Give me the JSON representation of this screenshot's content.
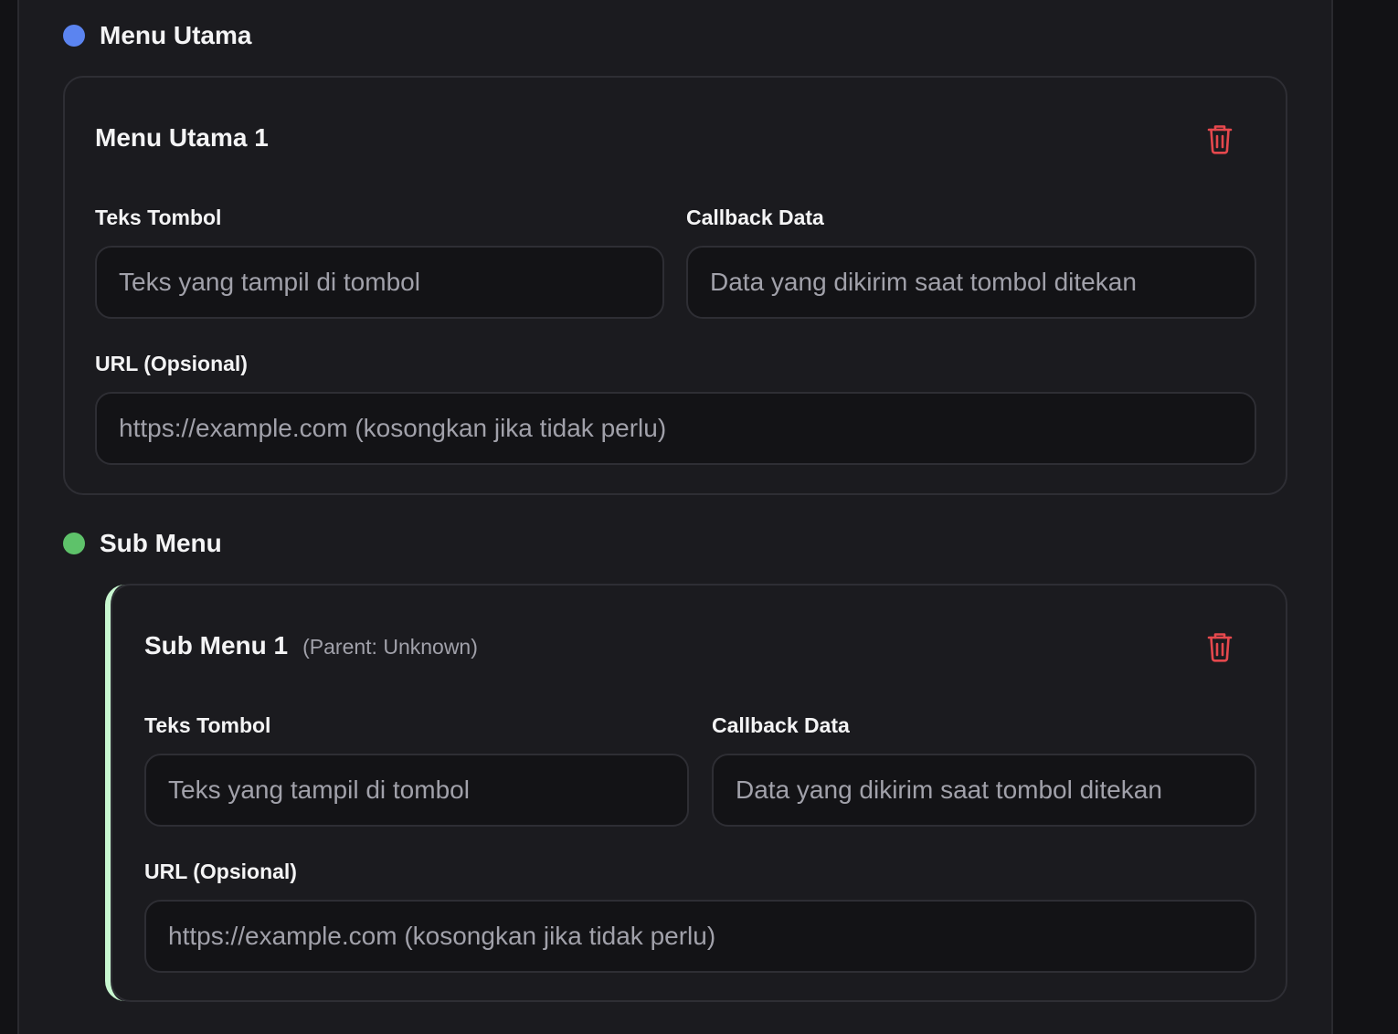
{
  "colors": {
    "menu_utama_dot": "#5b84f0",
    "sub_menu_dot": "#5ec26a",
    "sub_accent": "#c8f7d0",
    "trash": "#e5484d"
  },
  "menu_utama": {
    "title": "Menu Utama",
    "icon": "dot-icon",
    "card": {
      "title": "Menu Utama 1",
      "delete_icon": "trash-icon",
      "teks_label": "Teks Tombol",
      "teks_placeholder": "Teks yang tampil di tombol",
      "callback_label": "Callback Data",
      "callback_placeholder": "Data yang dikirim saat tombol ditekan",
      "url_label": "URL (Opsional)",
      "url_placeholder": "https://example.com (kosongkan jika tidak perlu)"
    }
  },
  "sub_menu": {
    "title": "Sub Menu",
    "icon": "dot-icon",
    "card": {
      "title": "Sub Menu 1",
      "parent": "(Parent: Unknown)",
      "delete_icon": "trash-icon",
      "teks_label": "Teks Tombol",
      "teks_placeholder": "Teks yang tampil di tombol",
      "callback_label": "Callback Data",
      "callback_placeholder": "Data yang dikirim saat tombol ditekan",
      "url_label": "URL (Opsional)",
      "url_placeholder": "https://example.com (kosongkan jika tidak perlu)"
    }
  }
}
